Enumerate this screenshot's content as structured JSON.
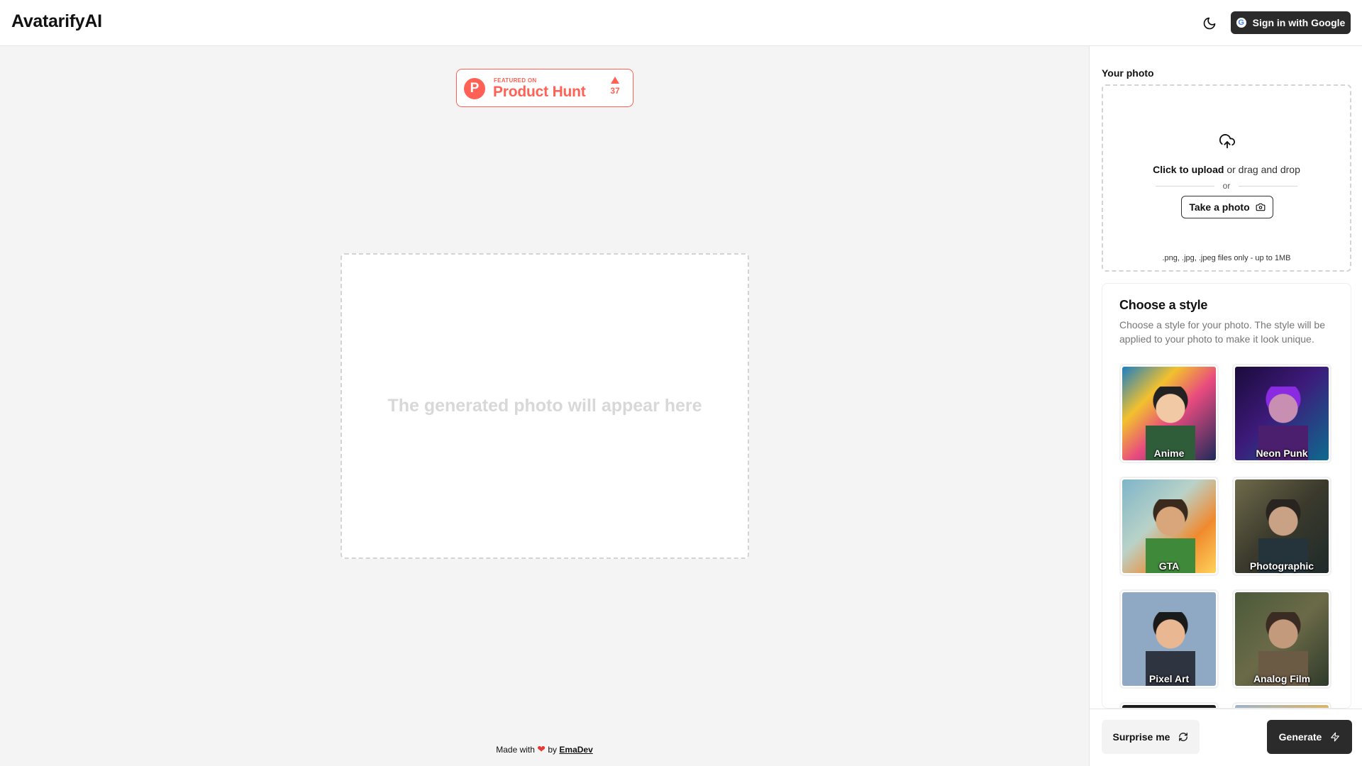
{
  "header": {
    "brand": "AvatarifyAI",
    "theme_icon": "moon-icon",
    "signin_label": "Sign in with Google",
    "google_icon": "google-icon"
  },
  "product_hunt": {
    "featured": "FEATURED ON",
    "name": "Product Hunt",
    "logo_letter": "P",
    "votes": "37",
    "color": "#ff6154"
  },
  "output": {
    "placeholder": "The generated photo will appear here"
  },
  "footer": {
    "made_with": "Made with",
    "by": "by",
    "author": "EmaDev"
  },
  "upload": {
    "label": "Your photo",
    "click_text": "Click to upload",
    "drag_text": "or drag and drop",
    "or": "or",
    "take_photo": "Take a photo",
    "note": ".png, .jpg, .jpeg files only - up to 1MB",
    "upload_icon": "cloud-upload-icon",
    "camera_icon": "camera-icon"
  },
  "styles": {
    "title": "Choose a style",
    "description": "Choose a style for your photo. The style will be applied to your photo to make it look unique.",
    "items": [
      {
        "label": "Anime"
      },
      {
        "label": "Neon Punk"
      },
      {
        "label": "GTA"
      },
      {
        "label": "Photographic"
      },
      {
        "label": "Pixel Art"
      },
      {
        "label": "Analog Film"
      }
    ]
  },
  "actions": {
    "surprise": "Surprise me",
    "surprise_icon": "shuffle-icon",
    "generate": "Generate",
    "generate_icon": "lightning-icon"
  },
  "colors": {
    "primary_button": "#2b2b2b",
    "accent": "#ff6154"
  }
}
